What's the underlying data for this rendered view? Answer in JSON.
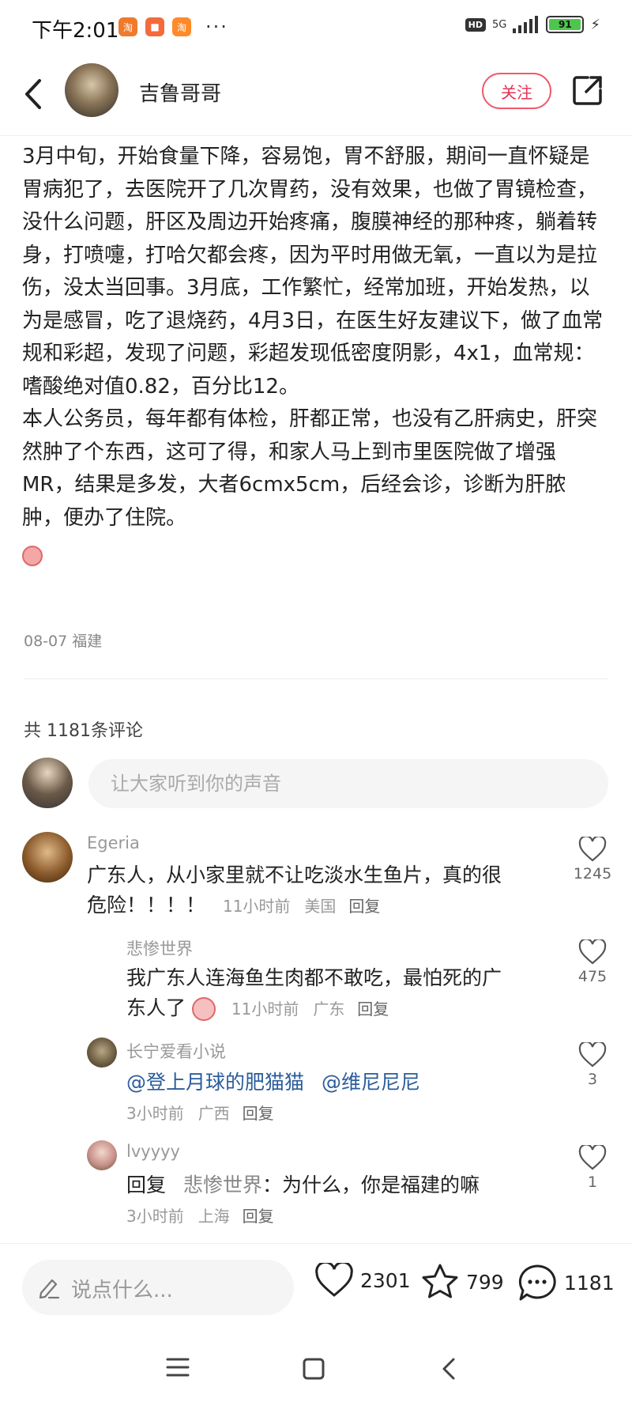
{
  "status_bar": {
    "time": "下午2:01",
    "apps": [
      "淘",
      "■",
      "淘"
    ],
    "dots": "···",
    "hd": "HD",
    "network": "5G",
    "battery": "91"
  },
  "header": {
    "author_name": "吉鲁哥哥",
    "follow_label": "关注"
  },
  "post": {
    "paragraph1": "3月中旬，开始食量下降，容易饱，胃不舒服，期间一直怀疑是胃病犯了，去医院开了几次胃药，没有效果，也做了胃镜检查，没什么问题，肝区及周边开始疼痛，腹膜神经的那种疼，躺着转身，打喷嚏，打哈欠都会疼，因为平时用做无氧，一直以为是拉伤，没太当回事。3月底，工作繁忙，经常加班，开始发热，以为是感冒，吃了退烧药，4月3日，在医生好友建议下，做了血常规和彩超，发现了问题，彩超发现低密度阴影，4x1，血常规：嗜酸绝对值0.82，百分比12。",
    "paragraph2": "本人公务员，每年都有体检，肝都正常，也没有乙肝病史，肝突然肿了个东西，这可了得，和家人马上到市里医院做了增强MR，结果是多发，大者6cmx5cm，后经会诊，诊断为肝脓肿，便办了住院。",
    "meta": "08-07 福建"
  },
  "comments_section": {
    "count_label": "共 1181条评论",
    "input_placeholder": "让大家听到你的声音"
  },
  "comments": [
    {
      "user": "Egeria",
      "text_line1": "广东人，从小家里就不让吃淡水生鱼片，真的很",
      "text_line2": "危险！！！！",
      "time": "11小时前",
      "location": "美国",
      "reply": "回复",
      "likes": "1245"
    },
    {
      "user": "悲惨世界",
      "text_line1": "我广东人连海鱼生肉都不敢吃，最怕死的广",
      "text_line2": "东人了",
      "time": "11小时前",
      "location": "广东",
      "reply": "回复",
      "likes": "475"
    },
    {
      "user": "长宁爱看小说",
      "mention1": "@登上月球的肥猫猫",
      "mention2": "@维尼尼尼",
      "time": "3小时前",
      "location": "广西",
      "reply": "回复",
      "likes": "3"
    },
    {
      "user": "lvyyyy",
      "reply_prefix": "回复",
      "reply_to": "悲惨世界",
      "text": "：为什么，你是福建的嘛",
      "time": "3小时前",
      "location": "上海",
      "reply": "回复",
      "likes": "1"
    }
  ],
  "bottom_bar": {
    "say_placeholder": "说点什么...",
    "likes": "2301",
    "stars": "799",
    "comments": "1181"
  },
  "colors": {
    "accent": "#e23553",
    "mention": "#2b5c9b",
    "muted": "#999999"
  }
}
